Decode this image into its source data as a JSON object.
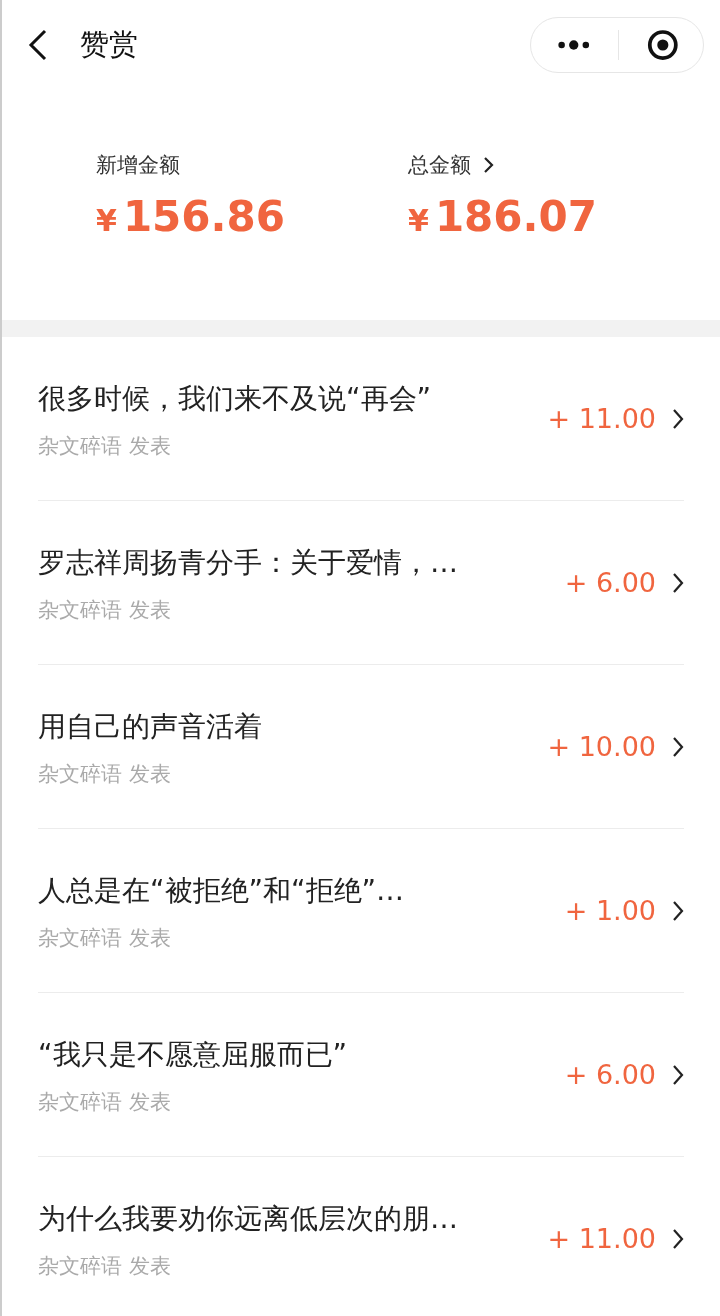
{
  "header": {
    "title": "赞赏"
  },
  "summary": [
    {
      "label": "新增金额",
      "currency": "¥",
      "amount": "156.86",
      "has_link": false
    },
    {
      "label": "总金额",
      "currency": "¥",
      "amount": "186.07",
      "has_link": true
    }
  ],
  "items": [
    {
      "title": "很多时候，我们来不及说“再会”",
      "source": "杂文碎语 发表",
      "amount": "+ 11.00"
    },
    {
      "title": "罗志祥周扬青分手：关于爱情，…",
      "source": "杂文碎语 发表",
      "amount": "+ 6.00"
    },
    {
      "title": "用自己的声音活着",
      "source": "杂文碎语 发表",
      "amount": "+ 10.00"
    },
    {
      "title": "人总是在“被拒绝”和“拒绝”…",
      "source": "杂文碎语 发表",
      "amount": "+ 1.00"
    },
    {
      "title": "“我只是不愿意屈服而已”",
      "source": "杂文碎语 发表",
      "amount": "+ 6.00"
    },
    {
      "title": "为什么我要劝你远离低层次的朋…",
      "source": "杂文碎语 发表",
      "amount": "+ 11.00"
    }
  ]
}
